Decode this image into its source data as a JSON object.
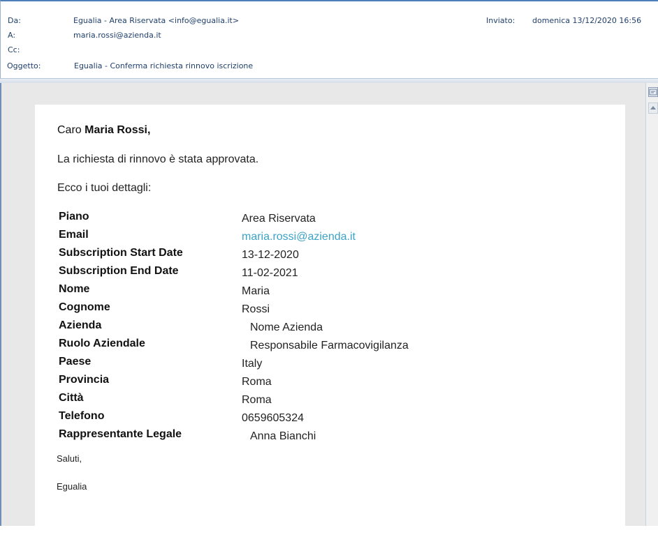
{
  "header": {
    "from_label": "Da:",
    "from_value": "Egualia - Area Riservata <info@egualia.it>",
    "to_label": "A:",
    "to_value": "maria.rossi@azienda.it",
    "cc_label": "Cc:",
    "subject_label": "Oggetto:",
    "subject_value": "Egualia - Conferma richiesta rinnovo iscrizione",
    "sent_label": "Inviato:",
    "sent_value": "domenica 13/12/2020 16:56"
  },
  "body": {
    "greeting_prefix": "Caro ",
    "greeting_name": "Maria Rossi,",
    "approved_text": "La richiesta di rinnovo è stata approvata.",
    "details_intro": "Ecco i tuoi dettagli:",
    "details": [
      {
        "key": "Piano",
        "value": "Area Riservata"
      },
      {
        "key": "Email",
        "value": "maria.rossi@azienda.it"
      },
      {
        "key": "Subscription Start Date",
        "value": "13-12-2020"
      },
      {
        "key": "Subscription End Date",
        "value": "11-02-2021"
      },
      {
        "key": "Nome",
        "value": "Maria"
      },
      {
        "key": "Cognome",
        "value": "Rossi"
      },
      {
        "key": "Azienda",
        "value": "Nome Azienda"
      },
      {
        "key": "Ruolo Aziendale",
        "value": "Responsabile Farmacovigilanza"
      },
      {
        "key": "Paese",
        "value": "Italy"
      },
      {
        "key": "Provincia",
        "value": "Roma"
      },
      {
        "key": "Città",
        "value": "Roma"
      },
      {
        "key": "Telefono",
        "value": "0659605324"
      },
      {
        "key": "Rappresentante Legale",
        "value": "Anna Bianchi"
      }
    ],
    "closing": "Saluti,",
    "signature": "Egualia"
  },
  "colors": {
    "header_text": "#1f3f6b",
    "link": "#3ba3c6",
    "viewer_background": "#e8e8e8"
  },
  "icons": {
    "scroll_top": "reading-pane-icon",
    "scroll_up": "chevron-up-icon"
  }
}
